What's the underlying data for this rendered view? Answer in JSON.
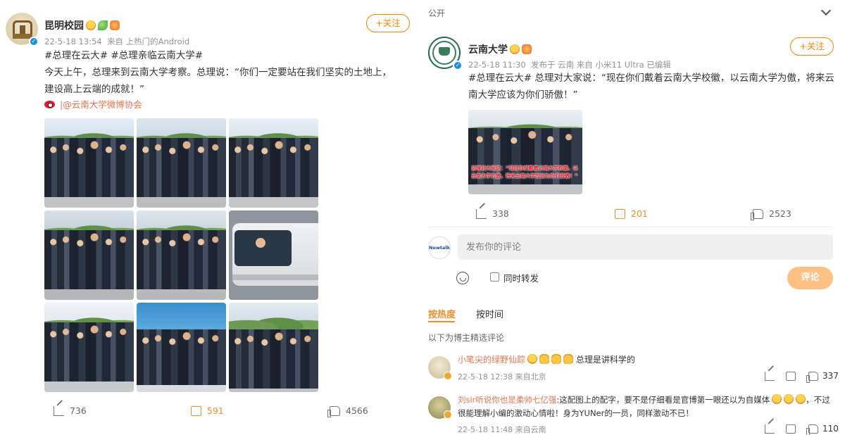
{
  "left_post": {
    "author": "昆明校园",
    "time": "22-5-18 13:54",
    "via": "来自 上热门的Android",
    "follow_label": "+关注",
    "topics": "#总理在云大# #总理亲临云南大学#",
    "text": "今天上午，总理来到云南大学考察。总理说：“你们一定要站在我们坚实的土地上，建设高上云端的成就！”",
    "source": "|@云南大学微博协会",
    "photo_count": 9,
    "reposts": "736",
    "comments": "591",
    "likes": "4566"
  },
  "right_post": {
    "visibility": "公开",
    "author": "云南大学",
    "time": "22-5-18 11:30",
    "via": "发布于 云南 来自 小米11 Ultra 已编辑",
    "follow_label": "+关注",
    "text": "#总理在云大# 总理对大家说：“现在你们戴着云南大学校徽，以云南大学为傲，将来云南大学应该为你们骄傲！”",
    "image_caption": "总理对大家说：“现在你们戴着云南大学校徽，以云南大学为傲，将来云南大学应该为你们骄傲！”",
    "reposts": "338",
    "comments": "201",
    "likes": "2523"
  },
  "composer": {
    "avatar_text": "Newtalk",
    "placeholder": "发布你的评论",
    "also_repost_label": "同时转发",
    "submit_label": "评论"
  },
  "comments_section": {
    "sort_hot": "按热度",
    "sort_time": "按时间",
    "note": "以下为博主精选评论",
    "items": [
      {
        "author": "小笔尖的绿野仙踪",
        "text": "总理是讲科学的",
        "time": "22-5-18 12:38 来自北京",
        "likes": "337"
      },
      {
        "author": "刘sir听说你也是柔帅七亿强",
        "text": ":这配图上的配字，要不是仔细看是官博第一眼还以为自媒体",
        "text_cont": "，不过很能理解小编的激动心情啦！身为YUNer的一员，同样激动不已！",
        "time": "22-5-18 11:48 来自云南",
        "likes": "110"
      }
    ]
  },
  "colors": {
    "accent": "#ff8200",
    "link": "#eb7350",
    "verified": "#1a8fe3",
    "submit_disabled": "#ffc183"
  }
}
